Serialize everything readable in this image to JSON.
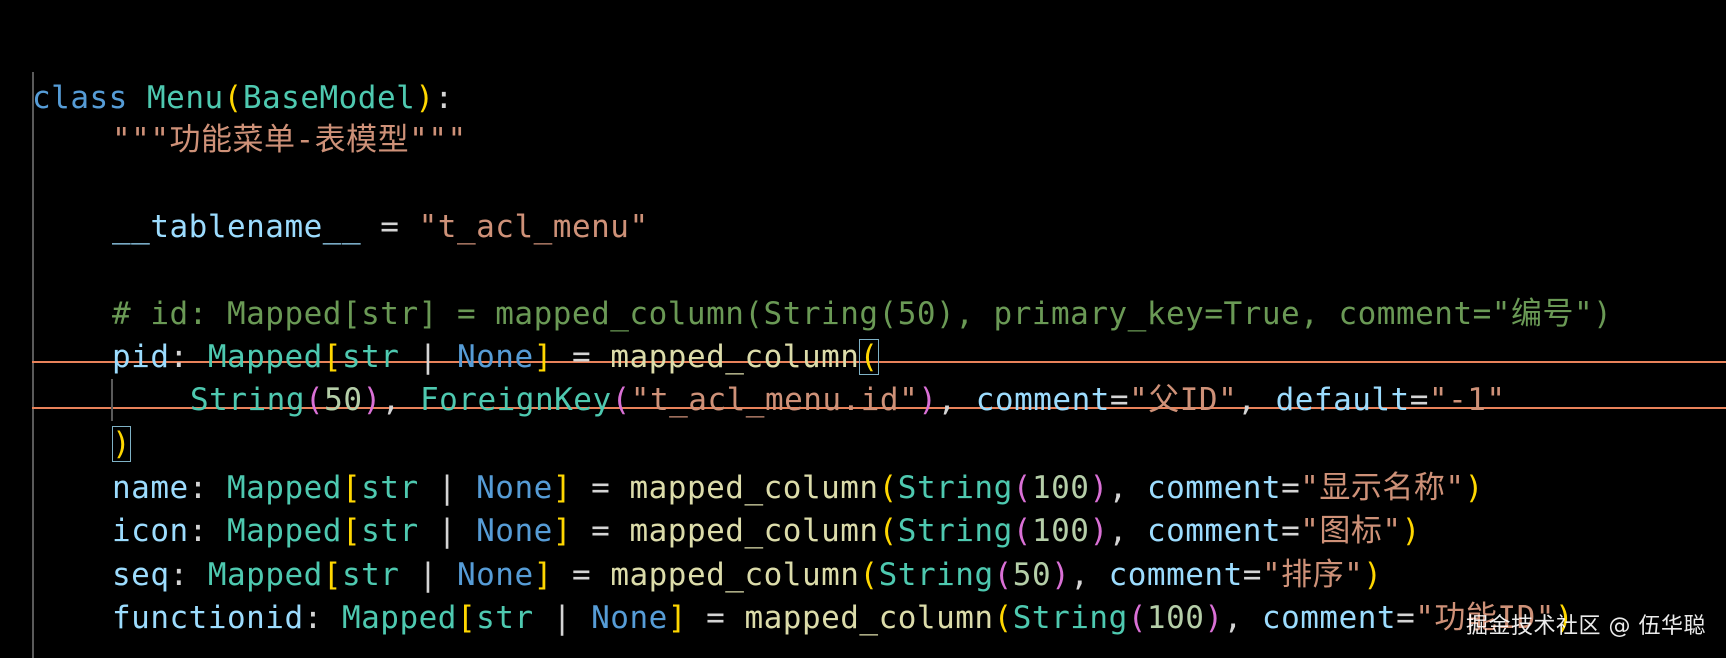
{
  "editor": {
    "colors": {
      "background": "#000000",
      "keyword": "#569cd6",
      "class": "#4ec9b0",
      "function": "#dcdcaa",
      "string": "#ce9178",
      "variable": "#9cdcfe",
      "number": "#b5cea8",
      "comment": "#6a9955",
      "bracket_level1": "#ffd700",
      "bracket_level2": "#da70d6",
      "bracket_level3": "#179fff",
      "line_highlight_border": "#e8825a"
    },
    "lines": {
      "l1": {
        "kw": "class",
        "cls": "Menu",
        "paren_open": "(",
        "base": "BaseModel",
        "paren_close": ")",
        "colon": ":"
      },
      "l2": {
        "docstring": "\"\"\"功能菜单-表模型\"\"\""
      },
      "l4": {
        "name": "__tablename__",
        "eq": " = ",
        "value": "\"t_acl_menu\""
      },
      "l6": {
        "comment": "# id: Mapped[str] = mapped_column(String(50), primary_key=True, comment=\"编号\")"
      },
      "l7": {
        "name": "pid",
        "colon": ": ",
        "type": "Mapped",
        "bo": "[",
        "t1": "str",
        "pipe": " | ",
        "t2": "None",
        "bc": "]",
        "eq": " = ",
        "fn": "mapped_column",
        "po": "("
      },
      "l8": {
        "cls1": "String",
        "po1": "(",
        "num1": "50",
        "pc1": ")",
        "comma1": ", ",
        "cls2": "ForeignKey",
        "po2": "(",
        "str2": "\"t_acl_menu.id\"",
        "pc2": ")",
        "comma2": ", ",
        "k1": "comment",
        "eq1": "=",
        "v1": "\"父ID\"",
        "comma3": ", ",
        "k2": "default",
        "eq2": "=",
        "v2": "\"-1\""
      },
      "l9": {
        "pc": ")"
      },
      "l10": {
        "name": "name",
        "colon": ": ",
        "type": "Mapped",
        "bo": "[",
        "t1": "str",
        "pipe": " | ",
        "t2": "None",
        "bc": "]",
        "eq": " = ",
        "fn": "mapped_column",
        "po": "(",
        "cls": "String",
        "po2": "(",
        "num": "100",
        "pc2": ")",
        "comma": ", ",
        "k": "comment",
        "eqk": "=",
        "v": "\"显示名称\"",
        "pc": ")"
      },
      "l11": {
        "name": "icon",
        "colon": ": ",
        "type": "Mapped",
        "bo": "[",
        "t1": "str",
        "pipe": " | ",
        "t2": "None",
        "bc": "]",
        "eq": " = ",
        "fn": "mapped_column",
        "po": "(",
        "cls": "String",
        "po2": "(",
        "num": "100",
        "pc2": ")",
        "comma": ", ",
        "k": "comment",
        "eqk": "=",
        "v": "\"图标\"",
        "pc": ")"
      },
      "l12": {
        "name": "seq",
        "colon": ": ",
        "type": "Mapped",
        "bo": "[",
        "t1": "str",
        "pipe": " | ",
        "t2": "None",
        "bc": "]",
        "eq": " = ",
        "fn": "mapped_column",
        "po": "(",
        "cls": "String",
        "po2": "(",
        "num": "50",
        "pc2": ")",
        "comma": ", ",
        "k": "comment",
        "eqk": "=",
        "v": "\"排序\"",
        "pc": ")"
      },
      "l13": {
        "name": "functionid",
        "colon": ": ",
        "type": "Mapped",
        "bo": "[",
        "t1": "str",
        "pipe": " | ",
        "t2": "None",
        "bc": "]",
        "eq": " = ",
        "fn": "mapped_column",
        "po": "(",
        "cls": "String",
        "po2": "(",
        "num": "100",
        "pc2": ")",
        "comma": ", ",
        "k": "comment",
        "eqk": "=",
        "v": "\"功能ID\"",
        "pc": ")"
      }
    }
  },
  "watermark": "掘金技术社区 @ 伍华聪"
}
